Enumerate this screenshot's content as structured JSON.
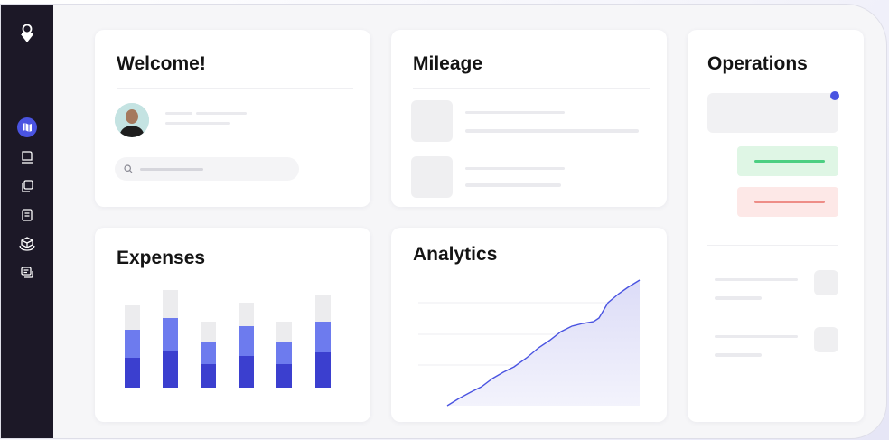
{
  "sidebar": {
    "icons": [
      "logo-icon",
      "map-icon",
      "inbox-icon",
      "copy-icon",
      "document-icon",
      "box-icon",
      "chat-icon"
    ],
    "active_color": "#4a54e1"
  },
  "welcome": {
    "title": "Welcome!"
  },
  "mileage": {
    "title": "Mileage"
  },
  "operations": {
    "title": "Operations"
  },
  "expenses": {
    "title": "Expenses"
  },
  "analytics": {
    "title": "Analytics"
  },
  "colors": {
    "accent": "#4a54e1",
    "accent_dark": "#3b3fcf",
    "accent_light": "#6d7bee",
    "bar_bg": "#ececee",
    "success_bg": "#dff6e5",
    "success_line": "#4ccf82",
    "danger_bg": "#fde8e7",
    "danger_line": "#ee8d87"
  }
}
